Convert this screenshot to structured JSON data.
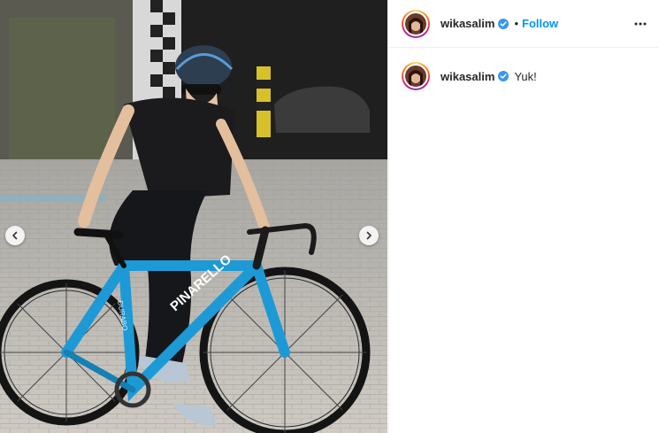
{
  "post": {
    "username": "wikasalim",
    "verified": true,
    "separator": "•",
    "follow_label": "Follow",
    "caption": "Yuk!"
  },
  "media": {
    "description_icon": "photo-of-woman-riding-road-bike",
    "frame_text": "PINARELLO",
    "frame_text_small": "DURABO"
  },
  "icons": {
    "prev": "chevron-left-icon",
    "next": "chevron-right-icon",
    "more": "more-horizontal-icon",
    "verified": "verified-badge-icon"
  },
  "colors": {
    "accent": "#0095f6",
    "frame": "#1d9ad6",
    "text": "#262626"
  }
}
